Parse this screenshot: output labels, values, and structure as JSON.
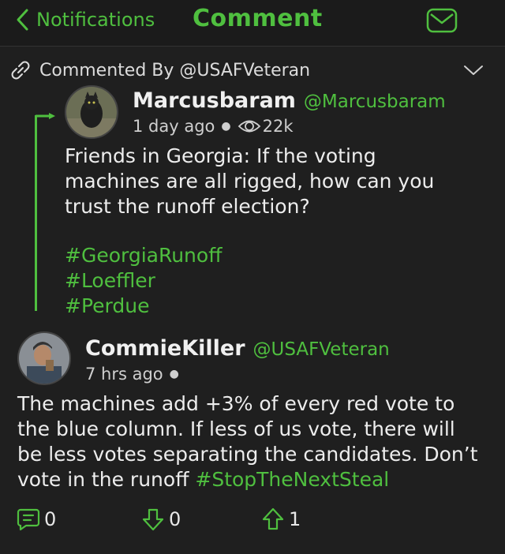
{
  "header": {
    "back_label": "Notifications",
    "title": "Comment",
    "icon": "mail-icon"
  },
  "context": {
    "label": "Commented By @USAFVeteran",
    "icon": "link-icon"
  },
  "original_post": {
    "author": "Marcusbaram",
    "handle": "@Marcusbaram",
    "time": "1 day ago",
    "views": "22k",
    "text": "Friends in Georgia: If the voting machines are all rigged, how can you trust the runoff election?",
    "hashtags": [
      "#GeorgiaRunoff",
      "#Loeffler",
      "#Perdue"
    ]
  },
  "comment": {
    "author": "CommieKiller",
    "handle": "@USAFVeteran",
    "time": "7 hrs ago",
    "text": "The machines add +3% of every red vote to the blue column. If less of us vote, there will be less votes separating the candidates. Don’t vote in the runoff",
    "hashtag": "#StopTheNextSteal"
  },
  "actions": {
    "reply_count": "0",
    "downvote_count": "0",
    "upvote_count": "1"
  },
  "colors": {
    "accent": "#4fbf3f",
    "background": "#1f1f1f"
  }
}
